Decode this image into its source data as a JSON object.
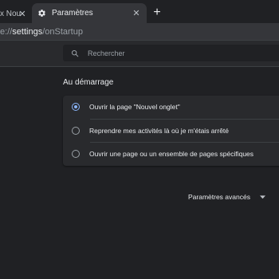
{
  "tabs": [
    {
      "title": "x Nou",
      "active": false
    },
    {
      "title": "Paramètres",
      "active": true
    }
  ],
  "address_bar": {
    "host_fragment": "e://",
    "path": "settings",
    "rest": "/onStartup"
  },
  "search": {
    "placeholder": "Rechercher"
  },
  "startup_section": {
    "title": "Au démarrage",
    "selected_index": 0,
    "options": [
      {
        "label": "Ouvrir la page \"Nouvel onglet\""
      },
      {
        "label": "Reprendre mes activités là où je m'étais arrêté"
      },
      {
        "label": "Ouvrir une page ou un ensemble de pages spécifiques"
      }
    ]
  },
  "advanced": {
    "label": "Paramètres avancés"
  },
  "icons": {
    "tab_favicon": "gear-icon",
    "tab_close": "close-icon",
    "new_tab": "plus-icon",
    "search": "search-icon",
    "advanced_toggle": "chevron-down-icon"
  },
  "colors": {
    "page_background": "#202124",
    "card_background": "#292a2d",
    "tab_active_background": "#35363a",
    "accent": "#8ab4f8",
    "text_primary": "#e8eaed",
    "text_secondary": "#9aa0a6"
  }
}
